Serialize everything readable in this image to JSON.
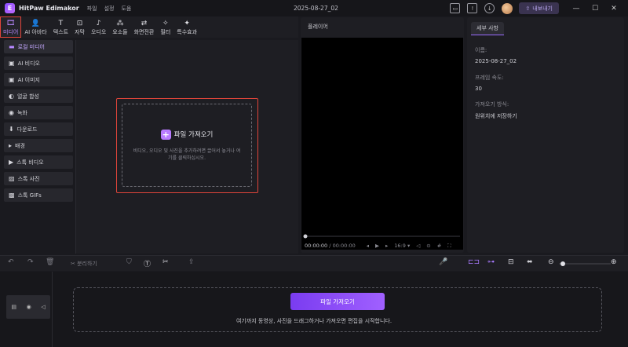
{
  "app": {
    "name": "HitPaw Edimakor",
    "logo_letter": "E",
    "menu": [
      "파일",
      "설정",
      "도움"
    ],
    "document_title": "2025-08-27_02",
    "export_label": "내보내기"
  },
  "toolbar": [
    {
      "icon": "media-icon",
      "glyph": "🎞",
      "label": "미디어",
      "active": true
    },
    {
      "icon": "ai-avatar-icon",
      "glyph": "👤",
      "label": "AI 아바타"
    },
    {
      "icon": "text-icon",
      "glyph": "T",
      "label": "텍스트"
    },
    {
      "icon": "subtitle-icon",
      "glyph": "⊡",
      "label": "자막"
    },
    {
      "icon": "audio-icon",
      "glyph": "♪",
      "label": "오디오"
    },
    {
      "icon": "elements-icon",
      "glyph": "⁂",
      "label": "요소들"
    },
    {
      "icon": "transition-icon",
      "glyph": "⇄",
      "label": "화면전환"
    },
    {
      "icon": "filter-icon",
      "glyph": "✧",
      "label": "필터"
    },
    {
      "icon": "effects-icon",
      "glyph": "✦",
      "label": "특수효과"
    }
  ],
  "sidebar": [
    {
      "icon": "folder-icon",
      "glyph": "▬",
      "label": "로컬 미디어",
      "selected": true
    },
    {
      "icon": "ai-video-icon",
      "glyph": "▣",
      "label": "AI 비디오"
    },
    {
      "icon": "ai-image-icon",
      "glyph": "▣",
      "label": "AI 이미지"
    },
    {
      "icon": "face-swap-icon",
      "glyph": "◐",
      "label": "얼굴 합성"
    },
    {
      "icon": "record-icon",
      "glyph": "◉",
      "label": "녹화"
    },
    {
      "icon": "download-icon",
      "glyph": "⬇",
      "label": "다운로드"
    },
    {
      "icon": "background-icon",
      "glyph": "▸",
      "label": "배경"
    },
    {
      "icon": "stock-video-icon",
      "glyph": "▶",
      "label": "스톡 비디오"
    },
    {
      "icon": "stock-photo-icon",
      "glyph": "▨",
      "label": "스톡 사진"
    },
    {
      "icon": "stock-gif-icon",
      "glyph": "▩",
      "label": "스톡 GIFs"
    }
  ],
  "import_box": {
    "title": "파일 가져오기",
    "description": "비디오, 오디오 및 사진을 추가하려면 끌어서 놓거나 여기를 클릭하십시오."
  },
  "player": {
    "title": "플레이어",
    "time_current": "00:00:00",
    "time_separator": "/",
    "time_total": "00:00:00",
    "aspect": "16:9"
  },
  "details": {
    "tab": "세부 사항",
    "fields": [
      {
        "label": "이름:",
        "value": "2025-08-27_02"
      },
      {
        "label": "프레임 속도:",
        "value": "30"
      },
      {
        "label": "가져오기 방식:",
        "value": "원위치에 저장하기"
      }
    ]
  },
  "timeline_toolbar": {
    "split_label": "분리하기"
  },
  "timeline": {
    "import_label": "파일 가져오기",
    "hint": "여기까지 동영상, 사진을 드래그하거나 가져오면 편집을 시작합니다."
  },
  "colors": {
    "accent": "#a060ff",
    "highlight": "#e0453a"
  }
}
